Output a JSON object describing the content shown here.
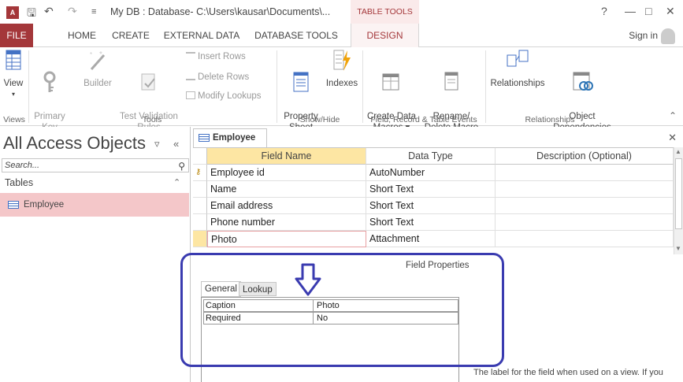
{
  "titlebar": {
    "title": "My DB : Database- C:\\Users\\kausar\\Documents\\...",
    "context_tab_group": "TABLE TOOLS",
    "help": "?"
  },
  "tabs": [
    "FILE",
    "HOME",
    "CREATE",
    "EXTERNAL DATA",
    "DATABASE TOOLS",
    "DESIGN"
  ],
  "signin": "Sign in",
  "ribbon": {
    "views": {
      "view_label": "View",
      "group": "Views"
    },
    "tools": {
      "primary_key": "Primary\nKey",
      "builder": "Builder",
      "test_validation": "Test Validation\nRules",
      "insert_rows": "Insert Rows",
      "delete_rows": "Delete Rows",
      "modify_lookups": "Modify Lookups",
      "group": "Tools"
    },
    "show_hide": {
      "property_sheet": "Property\nSheet",
      "indexes": "Indexes",
      "group": "Show/Hide"
    },
    "events": {
      "create_data_macros": "Create Data\nMacros ▾",
      "rename_delete_macro": "Rename/\nDelete Macro",
      "group": "Field, Record & Table Events"
    },
    "relationships": {
      "relationships": "Relationships",
      "object_dependencies": "Object\nDependencies",
      "group": "Relationships"
    }
  },
  "nav": {
    "title": "All Access Objects",
    "search_placeholder": "Search...",
    "group": "Tables",
    "items": [
      "Employee"
    ]
  },
  "doc": {
    "tab": "Employee",
    "columns": [
      "Field Name",
      "Data Type",
      "Description (Optional)"
    ],
    "rows": [
      {
        "field": "Employee id",
        "type": "AutoNumber",
        "key": true
      },
      {
        "field": "Name",
        "type": "Short Text"
      },
      {
        "field": "Email address",
        "type": "Short Text"
      },
      {
        "field": "Phone number",
        "type": "Short Text"
      },
      {
        "field": "Photo",
        "type": "Attachment",
        "selected": true
      }
    ],
    "field_properties_title": "Field Properties",
    "prop_tabs": [
      "General",
      "Lookup"
    ],
    "props": [
      {
        "k": "Caption",
        "v": "Photo"
      },
      {
        "k": "Required",
        "v": "No"
      }
    ],
    "help_text": "The label for the field when used on a view. If you"
  },
  "colors": {
    "accent": "#a4373a",
    "selection": "#f4c7c9",
    "annotation": "#3a3bb0",
    "header_highlight": "#fde6a3"
  }
}
